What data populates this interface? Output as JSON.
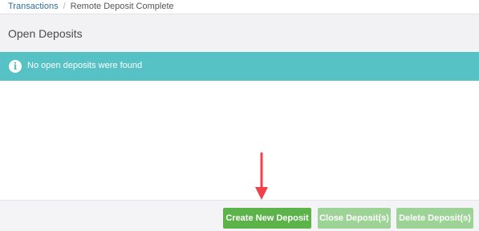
{
  "breadcrumb": {
    "root": "Transactions",
    "separator": "/",
    "current": "Remote Deposit Complete"
  },
  "panel": {
    "title": "Open Deposits"
  },
  "alert": {
    "icon": "info-icon",
    "message": "No open deposits were found"
  },
  "footer": {
    "create_label": "Create New Deposit",
    "close_label": "Close Deposit(s)",
    "delete_label": "Delete Deposit(s)"
  },
  "colors": {
    "alert_bg": "#57c2c5",
    "primary_button": "#5bb34a",
    "disabled_button": "#9dd396",
    "annotation_arrow": "#f0404a"
  }
}
